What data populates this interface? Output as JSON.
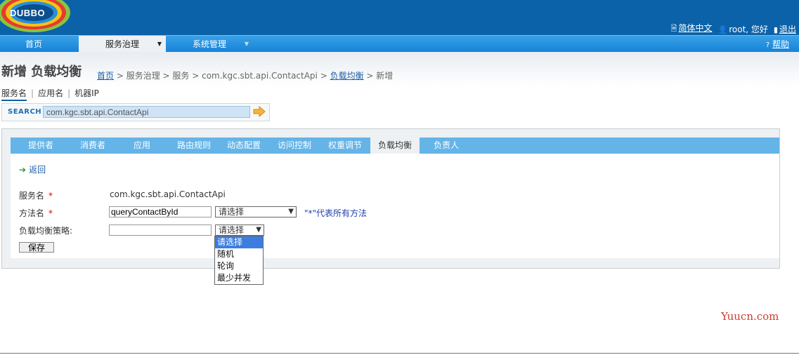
{
  "brand": {
    "logo_text": "DUBBO"
  },
  "topright": {
    "language": "简体中文",
    "user": "root, 您好",
    "logout": "退出"
  },
  "nav": {
    "items": [
      {
        "label": "首页"
      },
      {
        "label": "服务治理"
      },
      {
        "label": "系统管理"
      }
    ],
    "help": "帮助"
  },
  "page": {
    "title": "新增 负载均衡"
  },
  "breadcrumb": {
    "home": "首页",
    "sep1": " > ",
    "governance": "服务治理",
    "sep2": " > ",
    "service": "服务",
    "sep3": " > ",
    "api": "com.kgc.sbt.api.ContactApi",
    "sep4": " > ",
    "lb": "负载均衡",
    "sep5": " > ",
    "current": "新增"
  },
  "search": {
    "tabs": [
      "服务名",
      "应用名",
      "机器IP"
    ],
    "label": "SEARCH",
    "value": "com.kgc.sbt.api.ContactApi"
  },
  "tabs": [
    "提供者",
    "消费者",
    "应用",
    "路由规则",
    "动态配置",
    "访问控制",
    "权重调节",
    "负载均衡",
    "负责人"
  ],
  "form": {
    "back": "返回",
    "service_label": "服务名",
    "service_value": "com.kgc.sbt.api.ContactApi",
    "method_label": "方法名",
    "method_value": "queryContactById",
    "method_select": "请选择",
    "method_hint": "\"*\"代表所有方法",
    "strategy_label": "负载均衡策略:",
    "strategy_value": "",
    "strategy_select": "请选择",
    "save": "保存",
    "required_mark": "*"
  },
  "dropdown": {
    "options": [
      "请选择",
      "随机",
      "轮询",
      "最少并发"
    ],
    "selected_index": 0
  },
  "watermark": "Yuucn.com",
  "colors": {
    "topbar": "#0b62a8",
    "nav": "#1482d8",
    "tab": "#64b4e8",
    "link": "#1c5fa8",
    "required": "#dd0000"
  }
}
